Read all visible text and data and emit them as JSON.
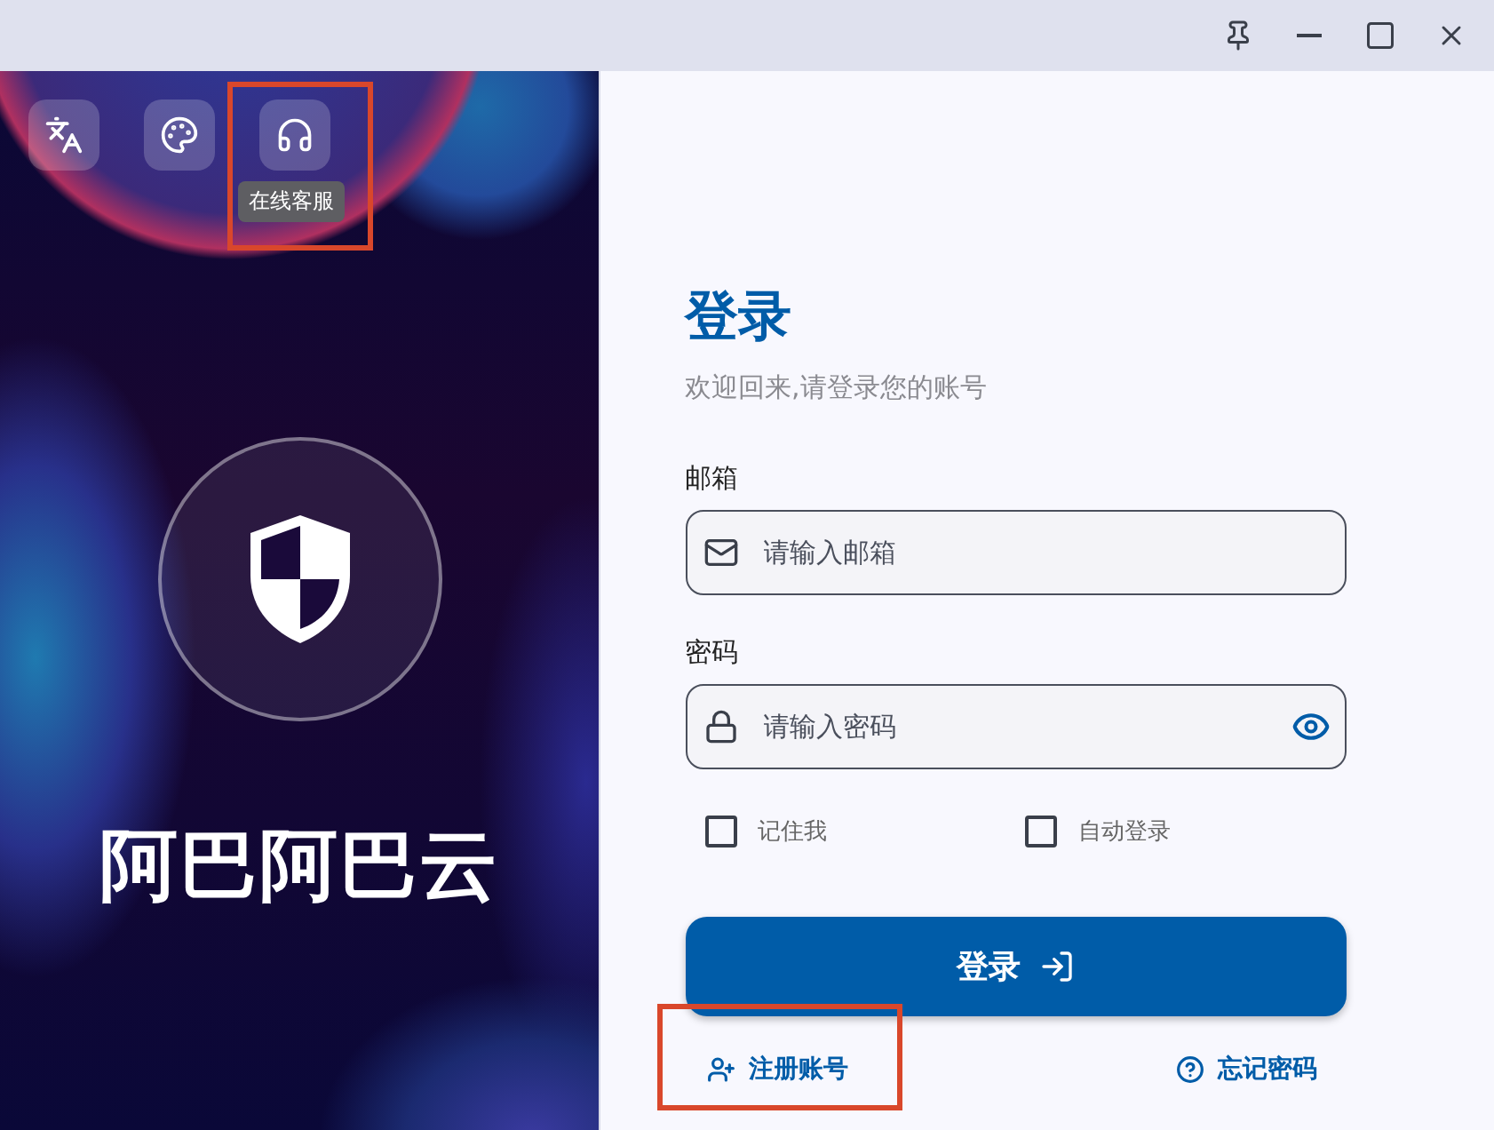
{
  "sidebar": {
    "tools": [
      {
        "kind": "translate",
        "highlighted": false
      },
      {
        "kind": "palette",
        "highlighted": false
      },
      {
        "kind": "support",
        "highlighted": true,
        "tooltip": "在线客服"
      }
    ],
    "brand": "阿巴阿巴云"
  },
  "form": {
    "title": "登录",
    "subtitle": "欢迎回来,请登录您的账号",
    "fields": [
      {
        "kind": "email",
        "label": "邮箱",
        "placeholder": "请输入邮箱"
      },
      {
        "kind": "password",
        "label": "密码",
        "placeholder": "请输入密码"
      }
    ],
    "options": [
      {
        "label": "记住我",
        "checked": false
      },
      {
        "label": "自动登录",
        "checked": false
      }
    ],
    "submit": "登录",
    "links": [
      {
        "kind": "register",
        "label": "注册账号",
        "highlighted": true
      },
      {
        "kind": "forgot",
        "label": "忘记密码",
        "highlighted": false
      }
    ]
  }
}
